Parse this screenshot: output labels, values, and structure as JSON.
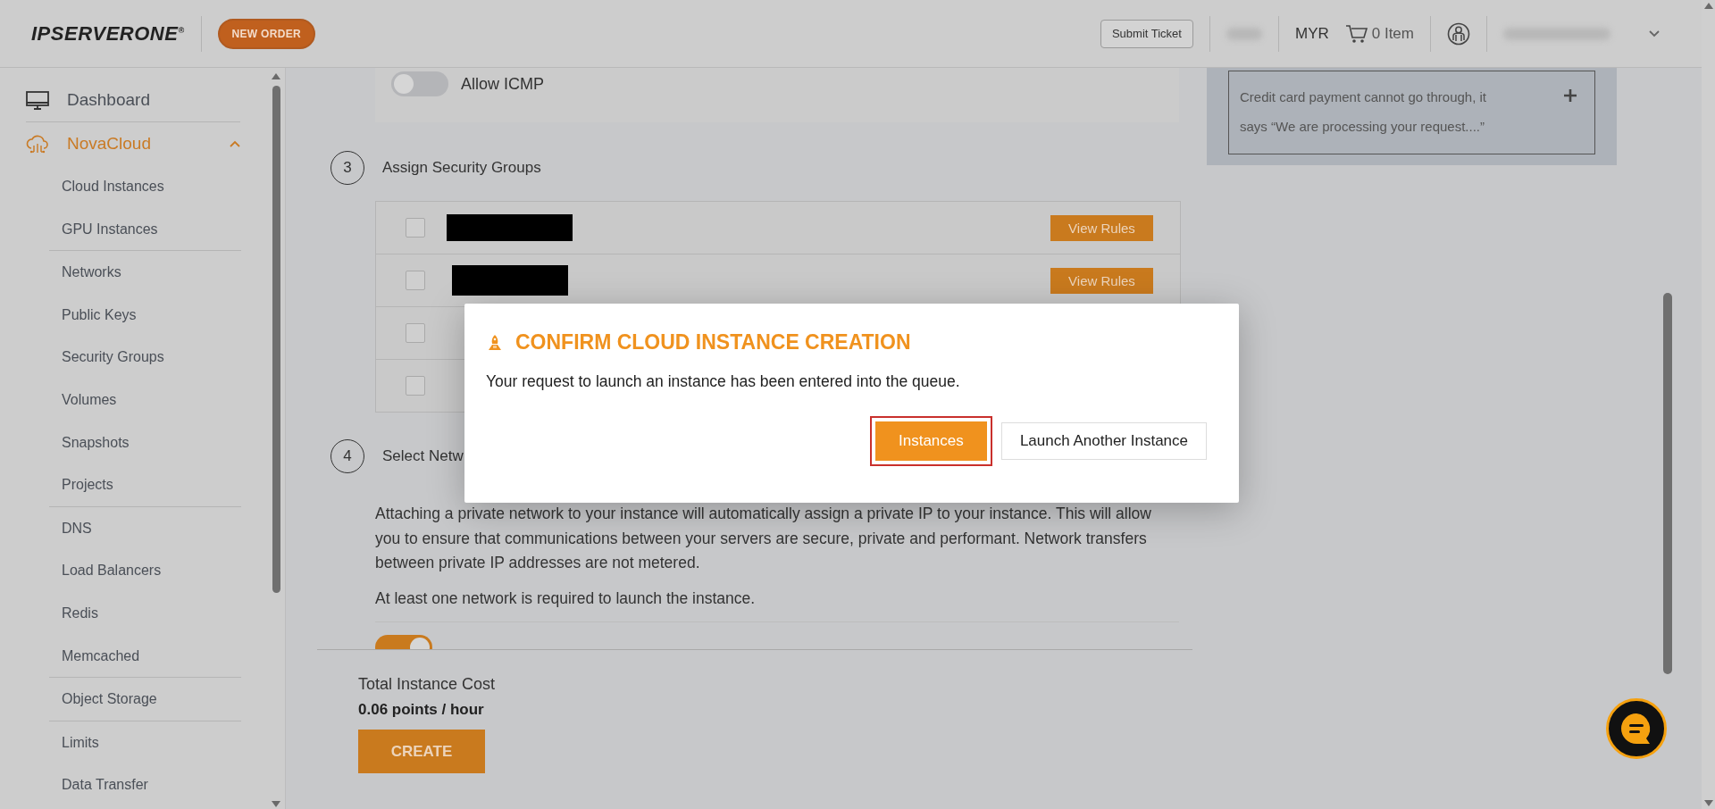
{
  "header": {
    "logo": "IPSERVERONE$^{®}$",
    "new_order": "NEW ORDER",
    "submit_ticket": "Submit Ticket",
    "currency": "MYR",
    "cart": "0 Item"
  },
  "sidebar": {
    "items": [
      {
        "label": "Dashboard",
        "kind": "monitor",
        "selected": false
      },
      {
        "label": "NovaCloud",
        "kind": "cloud",
        "selected": true,
        "expanded": true,
        "groups": [
          [
            "Cloud Instances",
            "GPU Instances"
          ],
          [
            "Networks",
            "Public Keys",
            "Security Groups",
            "Volumes",
            "Snapshots",
            "Projects"
          ],
          [
            "DNS",
            "Load Balancers",
            "Redis",
            "Memcached"
          ],
          [
            "Object Storage"
          ],
          [
            "Limits",
            "Data Transfer"
          ]
        ]
      }
    ]
  },
  "icmp_toggle": {
    "label": "Allow ICMP",
    "on": false
  },
  "security_step": {
    "number": "3",
    "title": "Assign Security Groups",
    "rows": [
      {
        "checked": false,
        "redacted": true,
        "button": "View Rules"
      },
      {
        "checked": false,
        "redacted": true,
        "button": "View Rules"
      },
      {
        "checked": false
      },
      {
        "checked": false
      }
    ]
  },
  "network_step": {
    "number": "4",
    "title": "Select Netw",
    "paragraphs": [
      "Attaching a private network to your instance will automatically assign a private IP to your instance. This will allow you to ensure that communications between your servers are secure, private and performant. Network transfers between private IP addresses are not metered.",
      "At least one network is required to launch the instance."
    ],
    "toggle": {
      "on": true
    }
  },
  "footer": {
    "label": "Total Instance Cost",
    "cost": "0.06 points / hour",
    "button": "CREATE"
  },
  "note": {
    "text": "Credit card payment cannot go through, it says “We are processing your request....”"
  },
  "modal": {
    "title": "CONFIRM CLOUD INSTANCE CREATION",
    "message": "Your request to launch an instance has been entered into the queue.",
    "buttons": [
      {
        "label": "Instances",
        "kind": "primary",
        "focused": true
      },
      {
        "label": "Launch Another Instance",
        "kind": "secondary",
        "focused": false
      }
    ]
  }
}
